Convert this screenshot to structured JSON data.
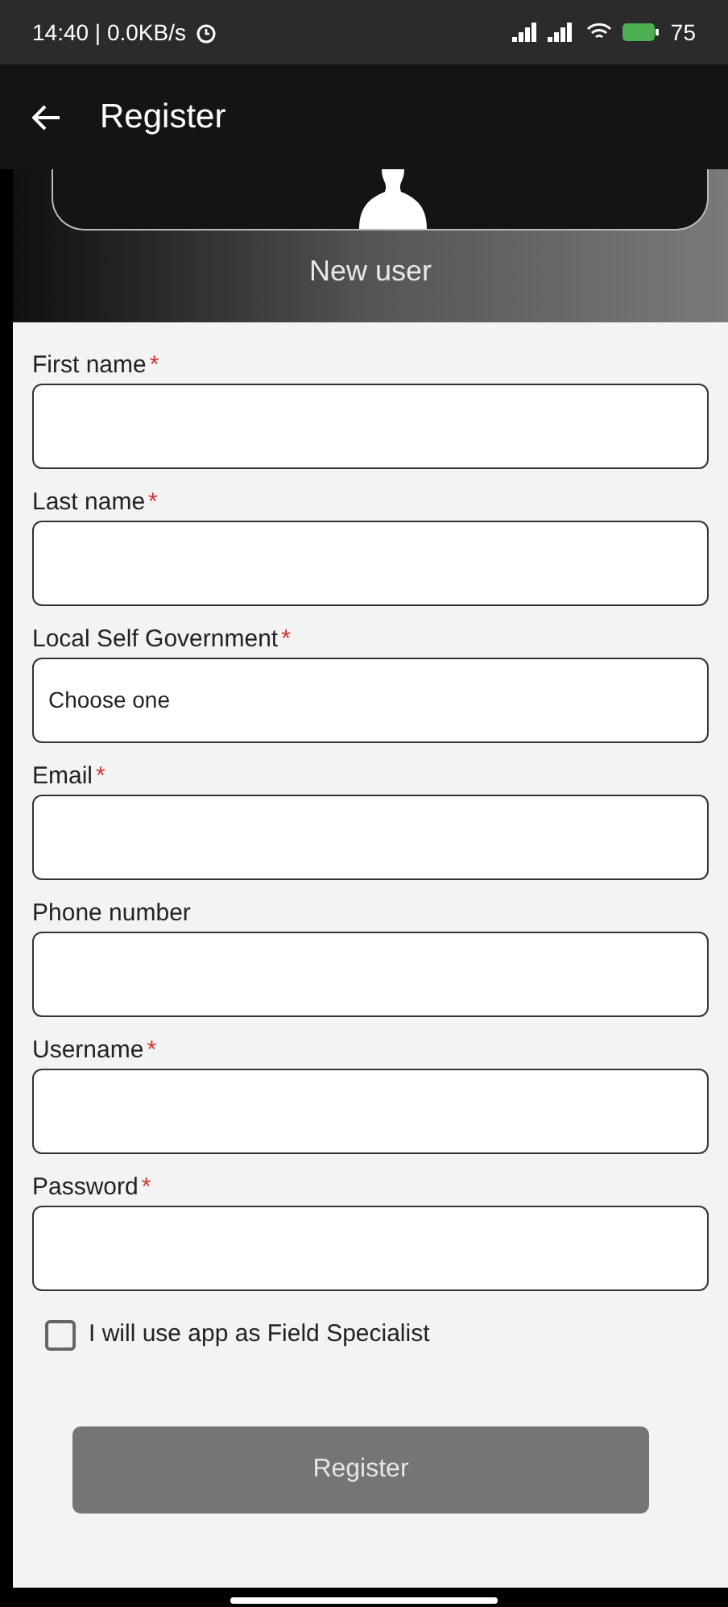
{
  "status_bar": {
    "left": "14:40 | 0.0KB/s",
    "battery": "75"
  },
  "app_bar": {
    "title": "Register"
  },
  "header": {
    "caption": "New user"
  },
  "fields": [
    {
      "label": "First name",
      "required": true,
      "kind": "text"
    },
    {
      "label": "Last name",
      "required": true,
      "kind": "text"
    },
    {
      "label": "Local Self Government",
      "required": true,
      "kind": "select",
      "value": "Choose one"
    },
    {
      "label": "Email",
      "required": true,
      "kind": "text"
    },
    {
      "label": "Phone number",
      "required": false,
      "kind": "text"
    },
    {
      "label": "Username",
      "required": true,
      "kind": "text"
    },
    {
      "label": "Password",
      "required": true,
      "kind": "text"
    }
  ],
  "required_mark": "*",
  "checkbox": {
    "label": "I will use app as Field Specialist",
    "checked": false
  },
  "submit": {
    "label": "Register",
    "disabled": true
  }
}
